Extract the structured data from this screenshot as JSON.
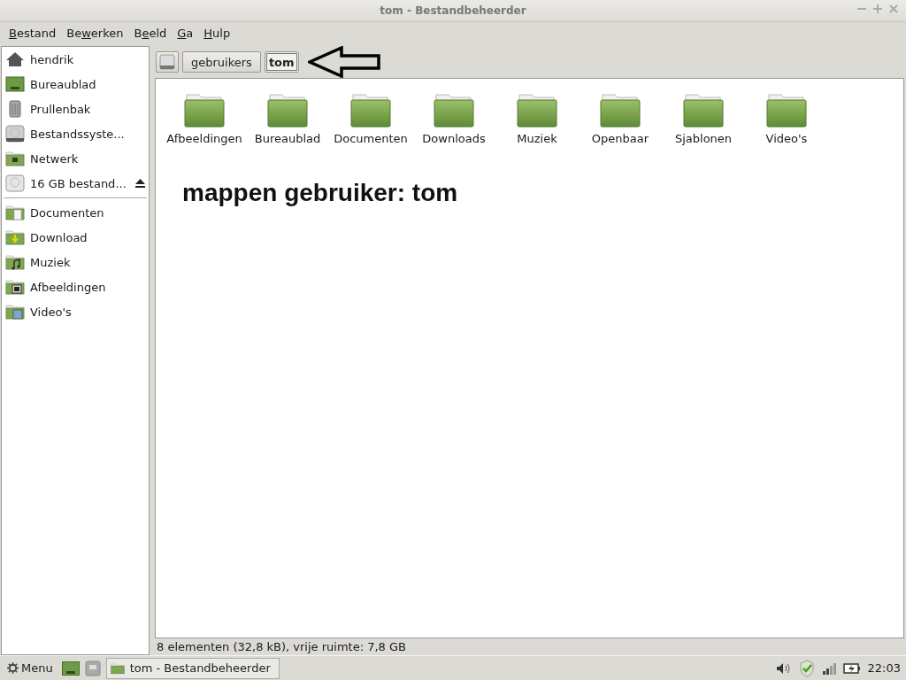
{
  "window": {
    "title": "tom - Bestandbeheerder"
  },
  "menu": [
    {
      "key": "B",
      "rest": "estand"
    },
    {
      "lead": "Be",
      "key": "w",
      "rest": "erken"
    },
    {
      "lead": "B",
      "key": "e",
      "rest": "eld"
    },
    {
      "key": "G",
      "rest": "a"
    },
    {
      "key": "H",
      "rest": "ulp"
    }
  ],
  "sidebar": {
    "groups": [
      [
        {
          "label": "hendrik",
          "kind": "home"
        },
        {
          "label": "Bureaublad",
          "kind": "desktop"
        },
        {
          "label": "Prullenbak",
          "kind": "trash"
        },
        {
          "label": "Bestandssyste...",
          "kind": "drive"
        },
        {
          "label": "Netwerk",
          "kind": "network"
        },
        {
          "label": "16 GB bestand...",
          "kind": "removable",
          "eject": true
        }
      ],
      [
        {
          "label": "Documenten",
          "kind": "documents"
        },
        {
          "label": "Download",
          "kind": "download"
        },
        {
          "label": "Muziek",
          "kind": "music"
        },
        {
          "label": "Afbeeldingen",
          "kind": "pictures"
        },
        {
          "label": "Video's",
          "kind": "videos"
        }
      ]
    ]
  },
  "path": [
    {
      "label": "gebruikers",
      "selected": false
    },
    {
      "label": "tom",
      "selected": true
    }
  ],
  "folders": [
    "Afbeeldingen",
    "Bureaublad",
    "Documenten",
    "Downloads",
    "Muziek",
    "Openbaar",
    "Sjablonen",
    "Video's"
  ],
  "annotation": "mappen gebruiker: tom",
  "status_bar": "8 elementen (32,8 kB), vrije ruimte: 7,8 GB",
  "taskbar": {
    "menu": "Menu",
    "task": "tom - Bestandbeheerder",
    "clock": "22:03"
  }
}
